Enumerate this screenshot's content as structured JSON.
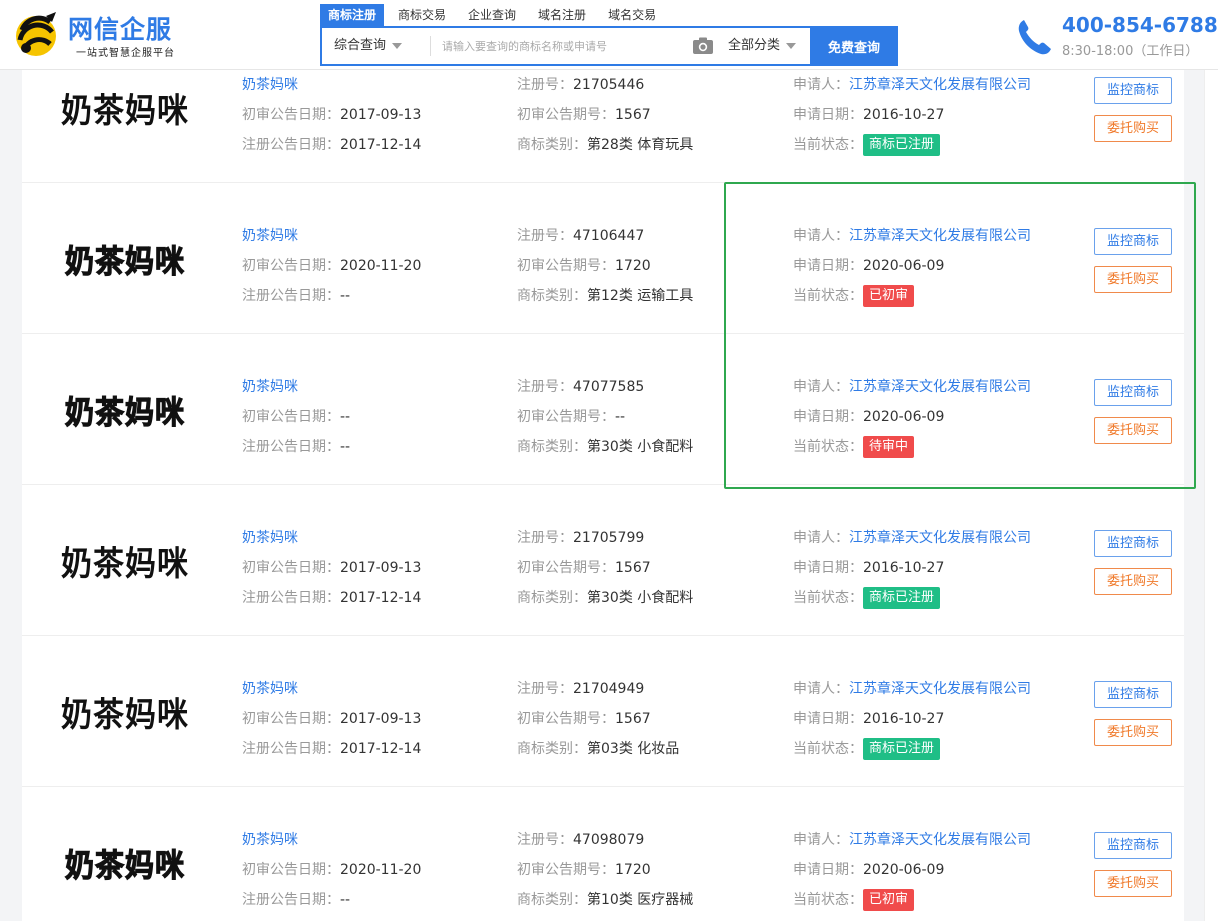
{
  "header": {
    "logo_title": "网信企服",
    "logo_subtitle": "一站式智慧企服平台",
    "phone": "400-854-6788",
    "hours": "8:30-18:00（工作日）"
  },
  "search": {
    "tabs": [
      "商标注册",
      "商标交易",
      "企业查询",
      "域名注册",
      "域名交易"
    ],
    "type_label": "综合查询",
    "placeholder": "请输入要查询的商标名称或申请号",
    "category_label": "全部分类",
    "submit_label": "免费查询"
  },
  "labels": {
    "initial_pub_date": "初审公告日期：",
    "reg_pub_date": "注册公告日期：",
    "reg_no": "注册号：",
    "initial_pub_issue": "初审公告期号：",
    "category": "商标类别：",
    "applicant": "申请人：",
    "apply_date": "申请日期：",
    "status": "当前状态：",
    "monitor_btn": "监控商标",
    "buy_btn": "委托购买"
  },
  "colors": {
    "accent": "#2f7be5",
    "status_registered": "#1fbe86",
    "status_pending": "#f04b4b",
    "highlight_border": "#2fa84f"
  },
  "rows": [
    {
      "brand": "奶茶妈咪",
      "name": "奶茶妈咪",
      "initial_date": "2017-09-13",
      "reg_date": "2017-12-14",
      "reg_no": "21705446",
      "issue": "1567",
      "category": "第28类 体育玩具",
      "applicant": "江苏章泽天文化发展有限公司",
      "apply_date": "2016-10-27",
      "status": "商标已注册",
      "status_type": "green"
    },
    {
      "brand": "奶茶妈咪",
      "name": "奶茶妈咪",
      "initial_date": "2020-11-20",
      "reg_date": "--",
      "reg_no": "47106447",
      "issue": "1720",
      "category": "第12类 运输工具",
      "applicant": "江苏章泽天文化发展有限公司",
      "apply_date": "2020-06-09",
      "status": "已初审",
      "status_type": "red"
    },
    {
      "brand": "奶茶妈咪",
      "name": "奶茶妈咪",
      "initial_date": "--",
      "reg_date": "--",
      "reg_no": "47077585",
      "issue": "--",
      "category": "第30类 小食配料",
      "applicant": "江苏章泽天文化发展有限公司",
      "apply_date": "2020-06-09",
      "status": "待审中",
      "status_type": "red"
    },
    {
      "brand": "奶茶妈咪",
      "name": "奶茶妈咪",
      "initial_date": "2017-09-13",
      "reg_date": "2017-12-14",
      "reg_no": "21705799",
      "issue": "1567",
      "category": "第30类 小食配料",
      "applicant": "江苏章泽天文化发展有限公司",
      "apply_date": "2016-10-27",
      "status": "商标已注册",
      "status_type": "green"
    },
    {
      "brand": "奶茶妈咪",
      "name": "奶茶妈咪",
      "initial_date": "2017-09-13",
      "reg_date": "2017-12-14",
      "reg_no": "21704949",
      "issue": "1567",
      "category": "第03类 化妆品",
      "applicant": "江苏章泽天文化发展有限公司",
      "apply_date": "2016-10-27",
      "status": "商标已注册",
      "status_type": "green"
    },
    {
      "brand": "奶茶妈咪",
      "name": "奶茶妈咪",
      "initial_date": "2020-11-20",
      "reg_date": "--",
      "reg_no": "47098079",
      "issue": "1720",
      "category": "第10类 医疗器械",
      "applicant": "江苏章泽天文化发展有限公司",
      "apply_date": "2020-06-09",
      "status": "已初审",
      "status_type": "red"
    }
  ]
}
